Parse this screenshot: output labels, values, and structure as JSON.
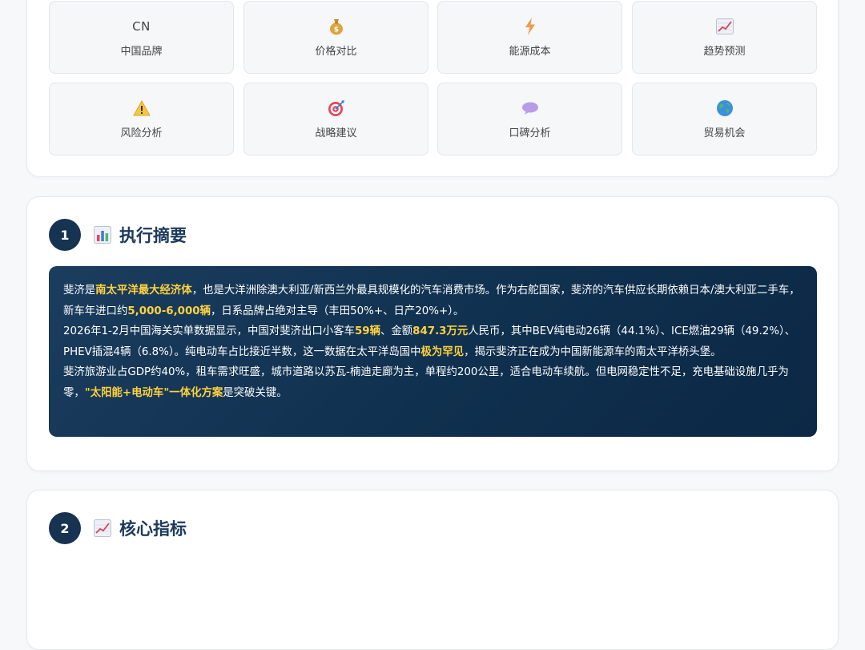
{
  "tiles": [
    {
      "icon_name": "cn-text-icon",
      "icon_text": "CN",
      "label": "中国品牌"
    },
    {
      "icon_name": "money-bag-icon",
      "label": "价格对比"
    },
    {
      "icon_name": "lightning-icon",
      "label": "能源成本"
    },
    {
      "icon_name": "trend-chart-icon",
      "label": "趋势预测"
    },
    {
      "icon_name": "warning-icon",
      "label": "风险分析"
    },
    {
      "icon_name": "target-icon",
      "label": "战略建议"
    },
    {
      "icon_name": "speech-bubble-icon",
      "label": "口碑分析"
    },
    {
      "icon_name": "globe-icon",
      "label": "贸易机会"
    }
  ],
  "summary": {
    "number": "1",
    "icon_name": "bar-chart-icon",
    "title": "执行摘要",
    "p1": {
      "a": "斐济是",
      "b": "南太平洋最大经济体",
      "c": "，也是大洋洲除澳大利亚/新西兰外最具规模化的汽车消费市场。作为右舵国家，斐济的汽车供应长期依赖日本/澳大利亚二手车，新车年进口约",
      "d": "5,000-6,000辆",
      "e": "，日系品牌占绝对主导（丰田50%+、日产20%+）。"
    },
    "p2": {
      "a": "2026年1-2月中国海关实单数据显示，中国对斐济出口小客车",
      "b": "59辆",
      "c": "、金额",
      "d": "847.3万元",
      "e": "人民币，其中BEV纯电动26辆（44.1%）、ICE燃油29辆（49.2%）、PHEV插混4辆（6.8%）。纯电动车占比接近半数，这一数据在太平洋岛国中",
      "f": "极为罕见",
      "g": "，揭示斐济正在成为中国新能源车的南太平洋桥头堡。"
    },
    "p3": {
      "a": "斐济旅游业占GDP约40%，租车需求旺盛，城市道路以苏瓦-楠迪走廊为主，单程约200公里，适合电动车续航。但电网稳定性不足，充电基础设施几乎为零，",
      "b": "\"太阳能+电动车\"一体化方案",
      "c": "是突破关键。"
    }
  },
  "metrics": {
    "number": "2",
    "icon_name": "trend-chart-icon",
    "title": "核心指标"
  },
  "colors": {
    "accent_navy": "#163352",
    "highlight": "#ffd23e",
    "title": "#1d3a5c"
  }
}
